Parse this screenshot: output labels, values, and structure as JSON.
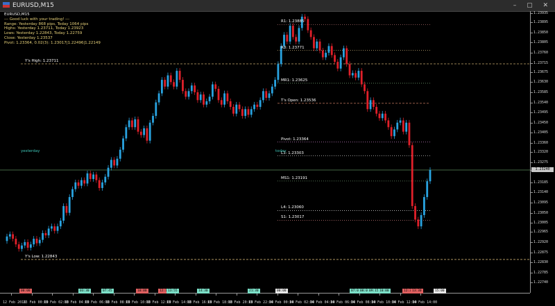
{
  "window": {
    "title": "EURUSD,M15",
    "buttons": "– ▢ ✕"
  },
  "info_panel": {
    "symbol": "EURUSD,M15",
    "lines": [
      "--- Good luck with your trading! ---",
      "Range: Yesterday 868 pips, Today 1064 pips",
      "Highs: Yesterday 1.23711, Today 1.23923",
      "Lows: Yesterday 1.22843, Today 1.22759",
      "Close: Yesterday 1.23537",
      "Pivot: 1.23364, 0.02(3): 1.23017|1.22496|1.22149"
    ]
  },
  "levels": [
    {
      "label": "R1: 1.23885",
      "price": 1.23885,
      "color": "#b06c6c",
      "style": "dot"
    },
    {
      "label": "R3: 1.23771",
      "price": 1.23771,
      "color": "#c8b078",
      "style": "dot"
    },
    {
      "label": "Y's High: 1.23711",
      "price": 1.23711,
      "color": "#c8aa6e",
      "style": "dash"
    },
    {
      "label": "MR1: 1.23625",
      "price": 1.23625,
      "color": "#6c9a6c",
      "style": "dot"
    },
    {
      "label": "T's Open: 1.23536",
      "price": 1.23536,
      "color": "#c87a60",
      "style": "dash"
    },
    {
      "label": "Pivot: 1.23364",
      "price": 1.23364,
      "color": "#b070b0",
      "style": "dot"
    },
    {
      "label": "L3: 1.23303",
      "price": 1.23303,
      "color": "#c8c8c8",
      "style": "dot"
    },
    {
      "label": "MS1: 1.23191",
      "price": 1.23191,
      "color": "#6c9a6c",
      "style": "dot"
    },
    {
      "label": "L4: 1.23060",
      "price": 1.2306,
      "color": "#c8c8c8",
      "style": "dot"
    },
    {
      "label": "S1: 1.23017",
      "price": 1.23017,
      "color": "#b06c6c",
      "style": "dot"
    },
    {
      "label": "Y's Low: 1.22843",
      "price": 1.22843,
      "color": "#c8aa6e",
      "style": "dash"
    }
  ],
  "side_labels": {
    "yesterday": "yesterday",
    "today": "today"
  },
  "current_price": {
    "label": "1.23240",
    "price": 1.2324
  },
  "price_axis": {
    "ylim": [
      1.22695,
      1.23945
    ],
    "ticks": [
      "1.23935",
      "1.23895",
      "1.23850",
      "1.23805",
      "1.23760",
      "1.23715",
      "1.23675",
      "1.23630",
      "1.23585",
      "1.23540",
      "1.23495",
      "1.23450",
      "1.23405",
      "1.23360",
      "1.23320",
      "1.23275",
      "1.23240",
      "1.23185",
      "1.23140",
      "1.23095",
      "1.23050",
      "1.23005",
      "1.22965",
      "1.22920",
      "1.22875",
      "1.22830",
      "1.22785",
      "1.22740"
    ]
  },
  "time_axis": {
    "labels": [
      "12 Feb 2018",
      "13 Feb 00:00",
      "13 Feb 02:00",
      "13 Feb 04:00",
      "13 Feb 06:00",
      "13 Feb 08:00",
      "13 Feb 10:00",
      "13 Feb 12:00",
      "13 Feb 14:00",
      "13 Feb 16:00",
      "13 Feb 18:00",
      "13 Feb 20:00",
      "13 Feb 22:00",
      "14 Feb 00:00",
      "14 Feb 02:00",
      "14 Feb 04:00",
      "14 Feb 06:00",
      "14 Feb 08:00",
      "14 Feb 10:00",
      "14 Feb 12:00",
      "14 Feb 14:00"
    ]
  },
  "news_markers": [
    {
      "label": "00:00",
      "color": "#e06060"
    },
    {
      "label": "03:30",
      "color": "#7ce0c8"
    },
    {
      "label": "07:45",
      "color": "#7ce0c8"
    },
    {
      "label": "10:00",
      "color": "#e06060"
    },
    {
      "label": "12:15",
      "color": "#e06060"
    },
    {
      "label": "13:55",
      "color": "#7ce0c8"
    },
    {
      "label": "14:30",
      "color": "#7ce0c8"
    },
    {
      "label": "21:30",
      "color": "#7ce0c8"
    },
    {
      "label": "00:00",
      "color": "#e8e8e8"
    },
    {
      "label": "07:00",
      "color": "#7ce0c8"
    },
    {
      "label": "08:00",
      "color": "#7ce0c8"
    },
    {
      "label": "09:15",
      "color": "#7ce0c8"
    },
    {
      "label": "10:00",
      "color": "#7ce0c8"
    },
    {
      "label": "12:30",
      "color": "#e06060"
    },
    {
      "label": "13:30",
      "color": "#e06060"
    },
    {
      "label": "15:00",
      "color": "#e8e8e8"
    }
  ],
  "colors": {
    "bull": "#29a3e0",
    "bear": "#e0202a",
    "background": "#000000",
    "current_line": "#5a8a5a"
  },
  "chart_data": {
    "type": "candlestick",
    "ylim": [
      1.22695,
      1.23945
    ],
    "closes": [
      1.22945,
      1.22955,
      1.22935,
      1.2291,
      1.2289,
      1.22905,
      1.2292,
      1.22895,
      1.2291,
      1.22935,
      1.22915,
      1.2293,
      1.2296,
      1.2295,
      1.2298,
      1.2299,
      1.2297,
      1.2299,
      1.23015,
      1.2308,
      1.2305,
      1.2312,
      1.23155,
      1.23185,
      1.2317,
      1.23195,
      1.2318,
      1.23225,
      1.232,
      1.2322,
      1.23195,
      1.2316,
      1.23185,
      1.2321,
      1.2325,
      1.23285,
      1.2326,
      1.2329,
      1.2333,
      1.2338,
      1.2343,
      1.2346,
      1.2343,
      1.23465,
      1.2341,
      1.23395,
      1.23425,
      1.2337,
      1.2345,
      1.2348,
      1.2354,
      1.2358,
      1.2364,
      1.2361,
      1.2366,
      1.2363,
      1.2361,
      1.2368,
      1.2364,
      1.2359,
      1.23565,
      1.2359,
      1.23615,
      1.23585,
      1.2355,
      1.23575,
      1.2353,
      1.23545,
      1.23565,
      1.2362,
      1.236,
      1.2355,
      1.2353,
      1.2358,
      1.23545,
      1.2352,
      1.2349,
      1.2353,
      1.2351,
      1.2348,
      1.2351,
      1.23485,
      1.2351,
      1.2353,
      1.2352,
      1.2355,
      1.2359,
      1.2356,
      1.2358,
      1.2361,
      1.2364,
      1.2371,
      1.2379,
      1.2384,
      1.2381,
      1.2388,
      1.2383,
      1.2381,
      1.2387,
      1.2392,
      1.2391,
      1.2386,
      1.2383,
      1.2378,
      1.2381,
      1.2377,
      1.2374,
      1.2376,
      1.2379,
      1.2375,
      1.2372,
      1.2369,
      1.2374,
      1.2378,
      1.2371,
      1.2366,
      1.2367,
      1.2365,
      1.2368,
      1.2362,
      1.2359,
      1.2351,
      1.2355,
      1.2352,
      1.2349,
      1.2347,
      1.2349,
      1.2346,
      1.2343,
      1.2339,
      1.2342,
      1.2345,
      1.2346,
      1.2341,
      1.2345,
      1.2335,
      1.2308,
      1.2302,
      1.2299,
      1.2304,
      1.2312,
      1.2319,
      1.2324
    ]
  }
}
